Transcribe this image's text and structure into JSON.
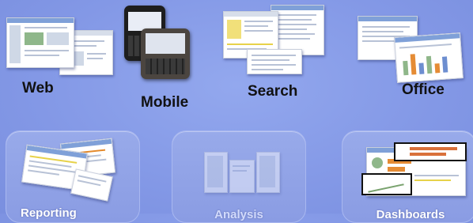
{
  "top_row": [
    {
      "label": "Web"
    },
    {
      "label": "Mobile"
    },
    {
      "label": "Search"
    },
    {
      "label": "Office"
    }
  ],
  "tiles": [
    {
      "label": "Reporting"
    },
    {
      "label": "Analysis"
    },
    {
      "label": "Dashboards"
    }
  ],
  "colors": {
    "background": "#8396e4",
    "tile": "#90a2e7",
    "label_text": "#111111",
    "tile_caption": "#ffffff"
  }
}
